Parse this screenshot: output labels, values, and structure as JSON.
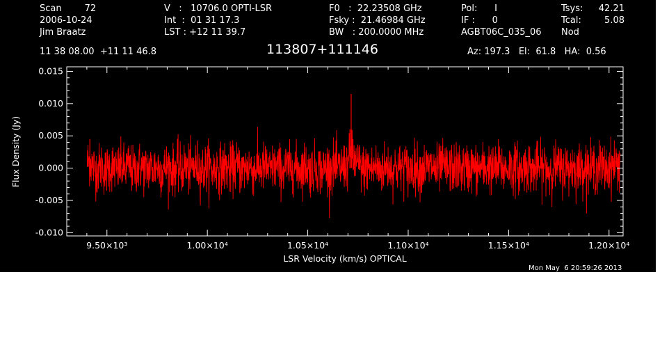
{
  "header": {
    "col1": [
      "Scan        72",
      "2006-10-24",
      "Jim Braatz"
    ],
    "col2": [
      "V   :   10706.0 OPTI-LSR",
      "Int  :  01 31 17.3",
      "LST : +12 11 39.7"
    ],
    "col3": [
      "F0   :  22.23508 GHz",
      "Fsky :  21.46984 GHz",
      "BW   : 200.0000 MHz"
    ],
    "col4": [
      "Pol:      I",
      "IF :      0",
      "AGBT06C_035_06"
    ],
    "col5_labels": [
      "Tsys:",
      "Tcal:",
      "Nod"
    ],
    "col5_values": [
      "42.21",
      "5.08",
      ""
    ],
    "coords": "11 38 08.00  +11 11 46.8",
    "source": "113807+111146",
    "azelha": "Az: 197.3   El:  61.8   HA:  0.56"
  },
  "timestamp": "Mon May  6 20:59:26 2013",
  "colors": {
    "background": "#000000",
    "axes": "#ffffff",
    "trace": "#ff0000"
  },
  "chart_data": {
    "type": "line",
    "xlabel": "LSR Velocity (km/s) OPTICAL",
    "ylabel": "Flux Density (Jy)",
    "xlim": [
      9300,
      12070
    ],
    "ylim": [
      -0.0105,
      0.0157
    ],
    "x_ticks": [
      9500,
      10000,
      10500,
      11000,
      11500,
      12000
    ],
    "x_tick_labels": [
      "9.50×10³",
      "1.00×10⁴",
      "1.05×10⁴",
      "1.10×10⁴",
      "1.15×10⁴",
      "1.20×10⁴"
    ],
    "y_ticks": [
      -0.01,
      -0.005,
      0.0,
      0.005,
      0.01,
      0.015
    ],
    "y_tick_labels": [
      "-0.010",
      "-0.005",
      "0.000",
      "0.005",
      "0.010",
      "0.015"
    ],
    "series": [
      {
        "color": "#ff0000",
        "x": [
          9402,
          9415,
          9430,
          9450,
          9470,
          9490,
          9510,
          9530,
          9550,
          9570,
          9590,
          9610,
          9630,
          9650,
          9670,
          9690,
          9710,
          9730,
          9750,
          9770,
          9790,
          9810,
          9830,
          9850,
          9870,
          9890,
          9910,
          9930,
          9950,
          9970,
          9990,
          10010,
          10030,
          10050,
          10070,
          10090,
          10110,
          10130,
          10150,
          10170,
          10190,
          10210,
          10230,
          10250,
          10270,
          10290,
          10310,
          10330,
          10350,
          10370,
          10390,
          10410,
          10430,
          10450,
          10470,
          10490,
          10510,
          10530,
          10550,
          10570,
          10590,
          10610,
          10630,
          10650,
          10670,
          10690,
          10705,
          10710,
          10716,
          10725,
          10740,
          10760,
          10780,
          10800,
          10820,
          10840,
          10860,
          10880,
          10900,
          10920,
          10940,
          10960,
          10980,
          11000,
          11020,
          11040,
          11060,
          11080,
          11100,
          11120,
          11140,
          11160,
          11180,
          11200,
          11220,
          11240,
          11260,
          11280,
          11300,
          11320,
          11340,
          11360,
          11380,
          11400,
          11420,
          11440,
          11460,
          11480,
          11500,
          11520,
          11540,
          11560,
          11580,
          11600,
          11620,
          11640,
          11660,
          11680,
          11700,
          11720,
          11740,
          11760,
          11780,
          11800,
          11820,
          11840,
          11860,
          11880,
          11900,
          11920,
          11940,
          11960,
          11980,
          12000,
          12020,
          12040,
          12055
        ],
        "y": [
          0.0035,
          0.0045,
          0.0008,
          -0.0012,
          0.0015,
          -0.0022,
          0.0005,
          0.0012,
          -0.0018,
          0.0009,
          -0.0006,
          0.0014,
          -0.0021,
          0.0002,
          0.0011,
          -0.0013,
          0.0007,
          -0.0004,
          0.0016,
          -0.0019,
          0.0003,
          0.001,
          -0.0015,
          0.0006,
          -0.0008,
          0.0013,
          -0.0011,
          0.0004,
          0.0017,
          -0.002,
          0.0001,
          0.0009,
          -0.0016,
          0.0008,
          -0.0003,
          0.0012,
          -0.0014,
          0.0005,
          0.0015,
          -0.0017,
          0.0002,
          0.0011,
          -0.0012,
          0.0007,
          -0.0005,
          0.0014,
          -0.0019,
          0.0003,
          0.001,
          -0.0013,
          0.0006,
          -0.0007,
          0.0013,
          -0.001,
          0.0004,
          0.0016,
          -0.0018,
          0.0002,
          0.0009,
          -0.0015,
          0.0008,
          -0.0004,
          0.0012,
          -0.0011,
          0.0006,
          0.0014,
          0.0035,
          0.006,
          0.0115,
          0.0045,
          0.0028,
          0.0016,
          -0.0014,
          0.0007,
          -0.0006,
          0.0012,
          -0.0016,
          0.0004,
          0.0011,
          -0.0012,
          0.0008,
          -0.0005,
          0.0015,
          -0.0019,
          0.0002,
          0.001,
          -0.0014,
          0.0006,
          -0.0003,
          0.0013,
          -0.0017,
          0.0003,
          0.0009,
          -0.0011,
          0.0007,
          -0.0008,
          0.0014,
          -0.0015,
          0.0001,
          0.0012,
          -0.0013,
          0.0005,
          -0.0004,
          0.0016,
          -0.0018,
          0.0002,
          0.001,
          -0.0012,
          0.0008,
          -0.0006,
          0.0013,
          -0.0016,
          0.0004,
          0.0011,
          -0.0014,
          0.0006,
          -0.0005,
          0.0015,
          -0.0017,
          0.0003,
          0.0009,
          -0.0011,
          0.0007,
          -0.0007,
          0.0012,
          -0.0015,
          0.0002,
          0.0014,
          -0.0013,
          0.0005,
          -0.0004,
          0.0016,
          -0.001,
          0.0008,
          0.0018,
          0.0025,
          0.003
        ]
      }
    ]
  }
}
